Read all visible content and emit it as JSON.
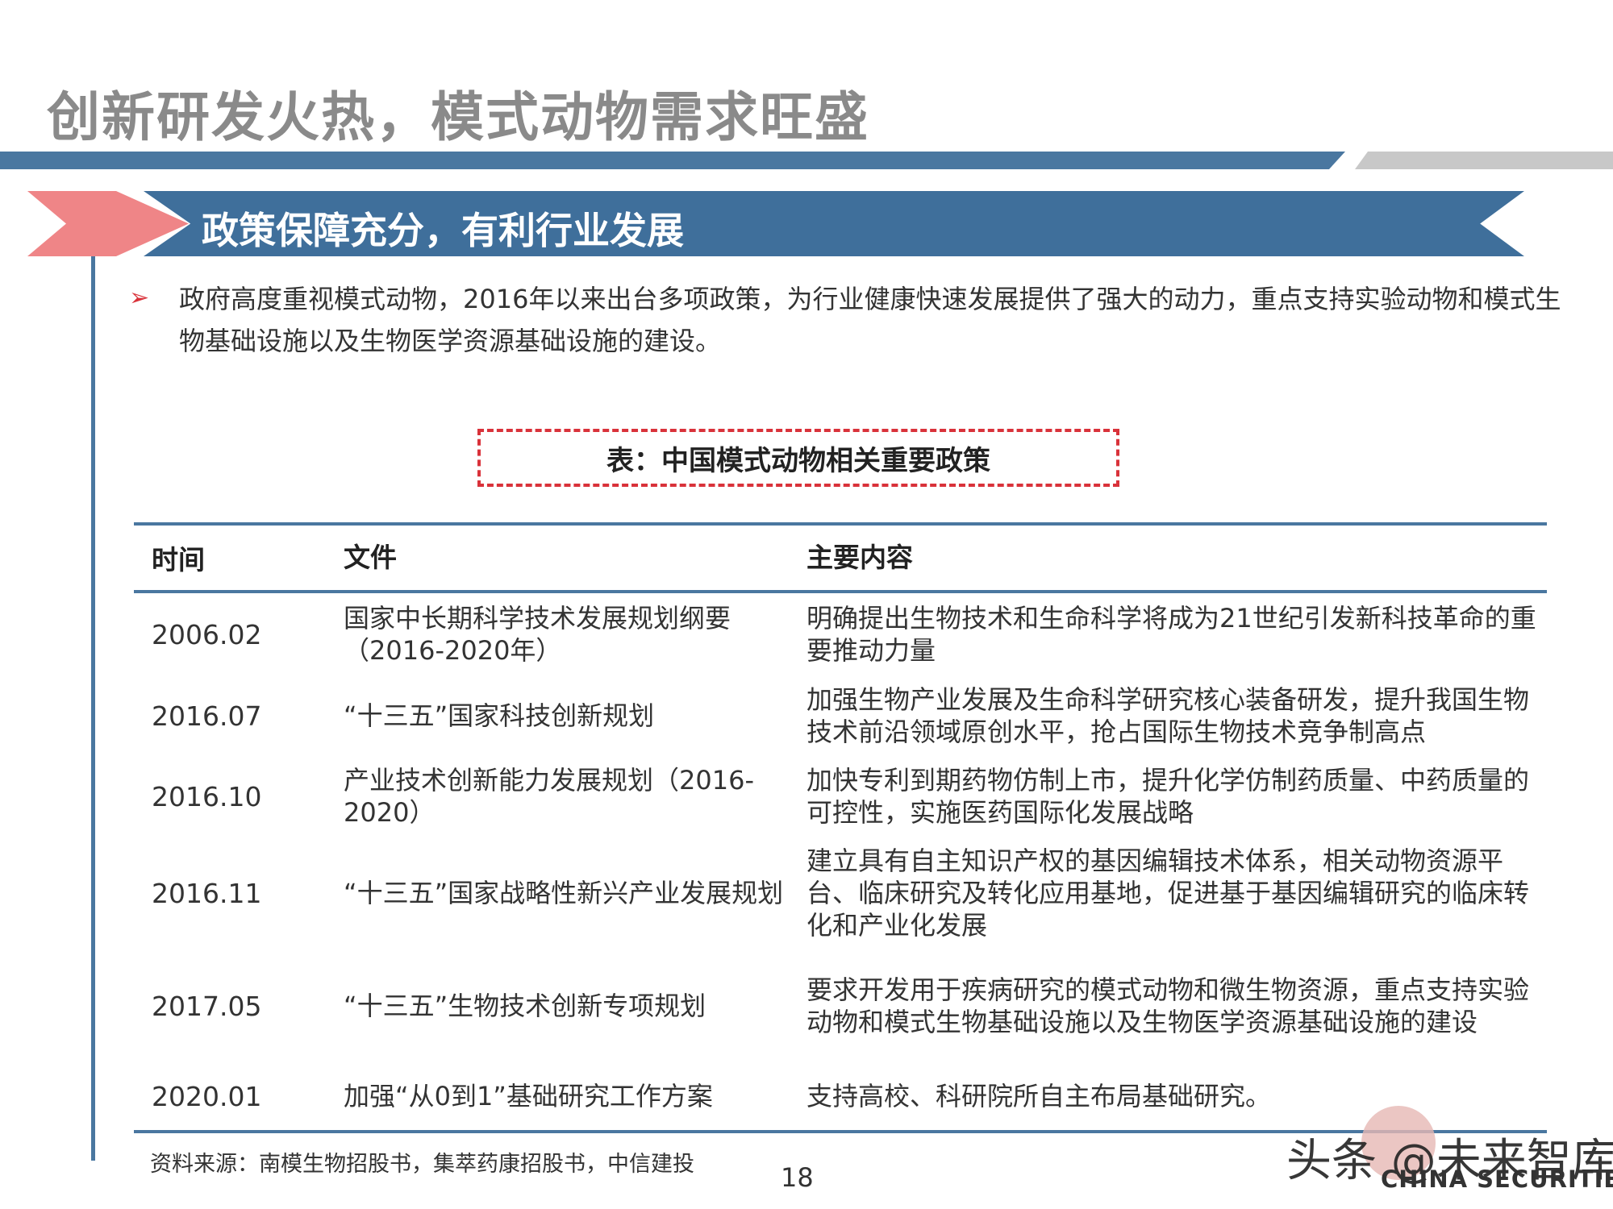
{
  "page": {
    "title": "创新研发火热，模式动物需求旺盛",
    "section_banner": "政策保障充分，有利行业发展",
    "bullet_marker": "➢",
    "intro": "政府高度重视模式动物，2016年以来出台多项政策，为行业健康快速发展提供了强大的动力，重点支持实验动物和模式生物基础设施以及生物医学资源基础设施的建设。",
    "table_caption": "表：中国模式动物相关重要政策",
    "source": "资料来源：南模生物招股书，集萃药康招股书，中信建投",
    "page_number": "18",
    "watermark": "头条 @未来智库",
    "logo_en": "CHINA SECURITIES"
  },
  "table": {
    "headers": {
      "time": "时间",
      "document": "文件",
      "content": "主要内容"
    },
    "rows": [
      {
        "time": "2006.02",
        "document": "国家中长期科学技术发展规划纲要（2016-2020年）",
        "content": "明确提出生物技术和生命科学将成为21世纪引发新科技革命的重要推动力量"
      },
      {
        "time": "2016.07",
        "document": "“十三五”国家科技创新规划",
        "content": "加强生物产业发展及生命科学研究核心装备研发，提升我国生物技术前沿领域原创水平，抢占国际生物技术竞争制高点"
      },
      {
        "time": "2016.10",
        "document": "产业技术创新能力发展规划（2016-2020）",
        "content": "加快专利到期药物仿制上市，提升化学仿制药质量、中药质量的可控性，实施医药国际化发展战略"
      },
      {
        "time": "2016.11",
        "document": "“十三五”国家战略性新兴产业发展规划",
        "content": "建立具有自主知识产权的基因编辑技术体系，相关动物资源平台、临床研究及转化应用基地，促进基于基因编辑研究的临床转化和产业化发展"
      },
      {
        "time": "2017.05",
        "document": "“十三五”生物技术创新专项规划",
        "content": "要求开发用于疾病研究的模式动物和微生物资源，重点支持实验动物和模式生物基础设施以及生物医学资源基础设施的建设"
      },
      {
        "time": "2020.01",
        "document": "加强“从0到1”基础研究工作方案",
        "content": "支持高校、科研院所自主布局基础研究。"
      }
    ]
  },
  "colors": {
    "title_gray": "#8a8a8a",
    "bar_blue": "#4a77a0",
    "banner_blue": "#3f6f9b",
    "banner_pink": "#ef8587",
    "accent_red": "#d9323a"
  }
}
